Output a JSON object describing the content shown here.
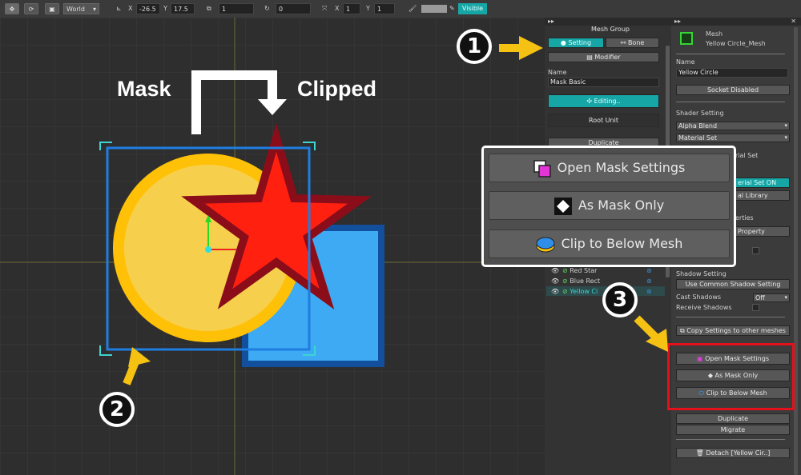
{
  "toolbar": {
    "space": "World",
    "pos_x_label": "X",
    "pos_x": "-26.5",
    "pos_y_label": "Y",
    "pos_y": "17.5",
    "depth": "1",
    "rotation": "0",
    "scale_x_label": "X",
    "scale_x": "1",
    "scale_y_label": "Y",
    "scale_y": "1",
    "visible": "Visible"
  },
  "viewport": {
    "mask_label": "Mask",
    "clipped_label": "Clipped",
    "colors": {
      "circle": "#ffc107",
      "star": "#ff2010",
      "rect": "#3eaaf3"
    }
  },
  "mid": {
    "title": "Mesh Group",
    "tab_setting": "Setting",
    "tab_bone": "Bone",
    "modifier": "Modifier",
    "name_label": "Name",
    "name_value": "Mask Basic",
    "editing": "Editing..",
    "root_unit": "Root Unit",
    "duplicate": "Duplicate",
    "layers": [
      "Red Star",
      "Blue Rect",
      "Yellow Ci"
    ]
  },
  "right": {
    "type_label": "Mesh",
    "mesh_name": "Yellow Circle_Mesh",
    "name_label": "Name",
    "name_value": "Yellow Circle",
    "socket": "Socket Disabled",
    "shader_label": "Shader Setting",
    "blend": "Alpha Blend",
    "material_set": "Material Set",
    "material_set_btn": "rial Set",
    "material_set_on": "erial Set ON",
    "material_library": "al Library",
    "properties": "erties",
    "property": "Property",
    "shadow_label": "Shadow Setting",
    "common_shadow": "Use Common Shadow Setting",
    "cast_label": "Cast Shadows",
    "cast_value": "Off",
    "receive_label": "Receive Shadows",
    "copy_settings": "Copy Settings to other meshes",
    "open_mask": "Open Mask Settings",
    "as_mask": "As Mask Only",
    "clip_below": "Clip to Below Mesh",
    "duplicate": "Duplicate",
    "migrate": "Migrate",
    "detach": "Detach [Yellow Cir..]"
  },
  "popup": {
    "open_mask": "Open Mask Settings",
    "as_mask": "As Mask Only",
    "clip_below": "Clip to Below Mesh"
  },
  "callouts": {
    "one": "1",
    "two": "2",
    "three": "3"
  }
}
